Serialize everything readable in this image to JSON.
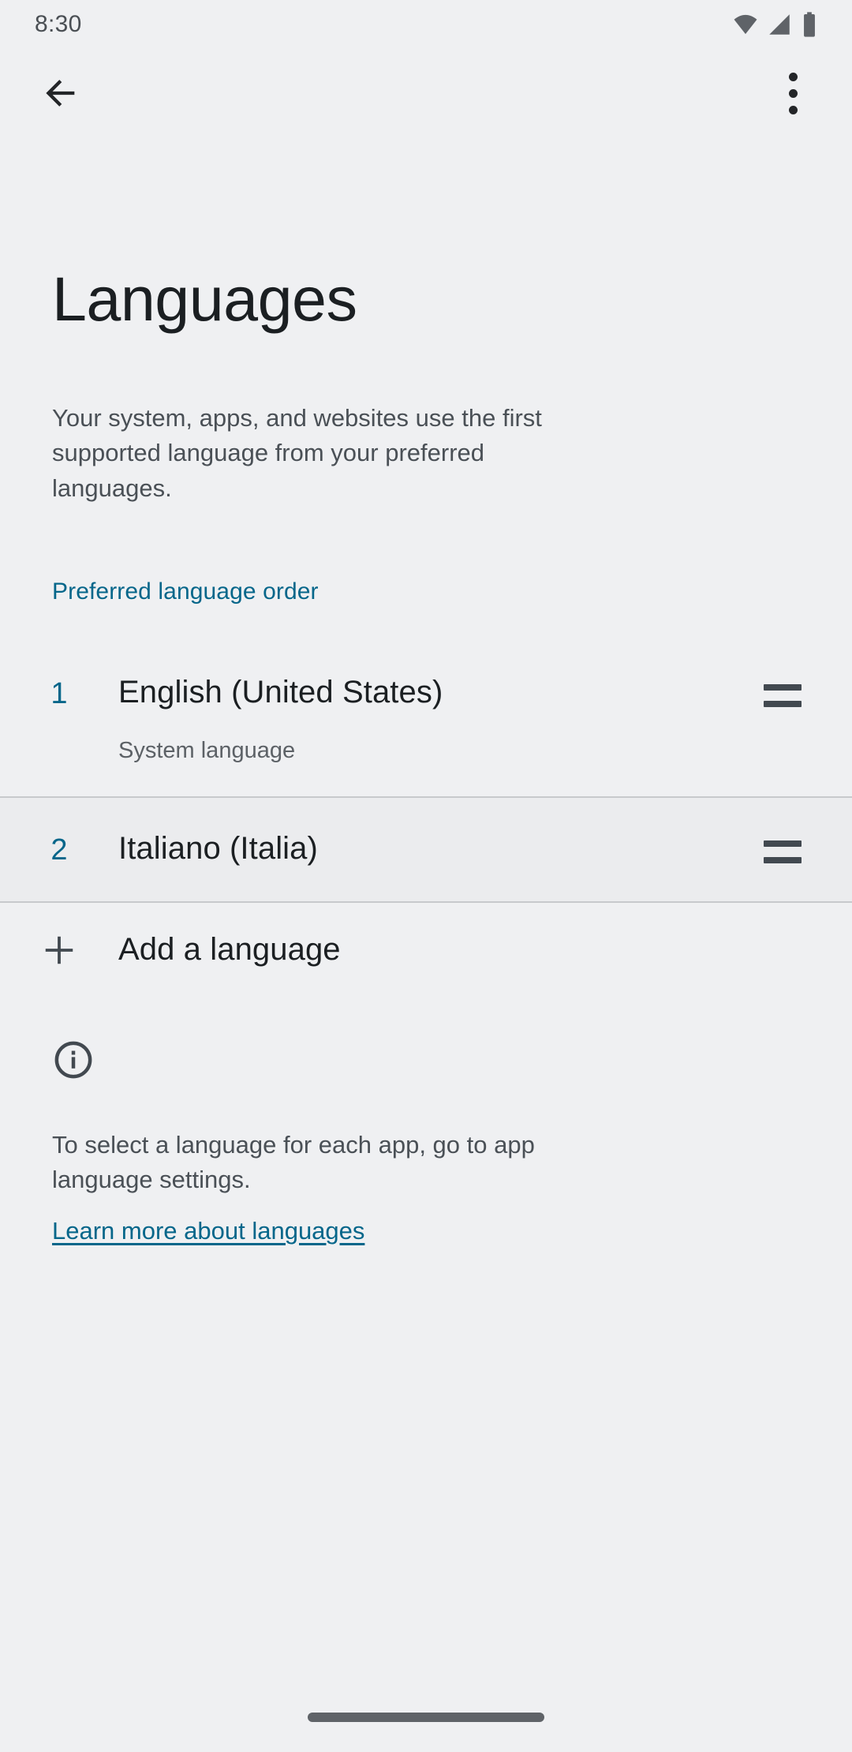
{
  "status_bar": {
    "time": "8:30",
    "icons": [
      "wifi-icon",
      "cellular-signal-icon",
      "battery-icon"
    ]
  },
  "app_bar": {
    "back_icon": "back-arrow-icon",
    "overflow_icon": "more-options-icon"
  },
  "header": {
    "title": "Languages",
    "description": "Your system, apps, and websites use the first supported language from your preferred languages."
  },
  "section": {
    "label": "Preferred language order"
  },
  "languages": [
    {
      "rank": "1",
      "name": "English (United States)",
      "subtitle": "System language",
      "drag_icon": "drag-handle-icon"
    },
    {
      "rank": "2",
      "name": "Italiano (Italia)",
      "subtitle": "",
      "drag_icon": "drag-handle-icon"
    }
  ],
  "add_language": {
    "icon": "plus-icon",
    "label": "Add a language"
  },
  "footer": {
    "icon": "info-circle-icon",
    "text": "To select a language for each app, go to app language settings.",
    "link": "Learn more about languages"
  },
  "nav_bar": {
    "home_indicator": "home-gesture-pill"
  },
  "colors": {
    "background": "#eff0f2",
    "accent": "#05668a",
    "primary_text": "#1b1f22",
    "secondary_text": "#4a5056",
    "divider": "#c7c9cc",
    "row_alt_background": "#ebecee"
  }
}
